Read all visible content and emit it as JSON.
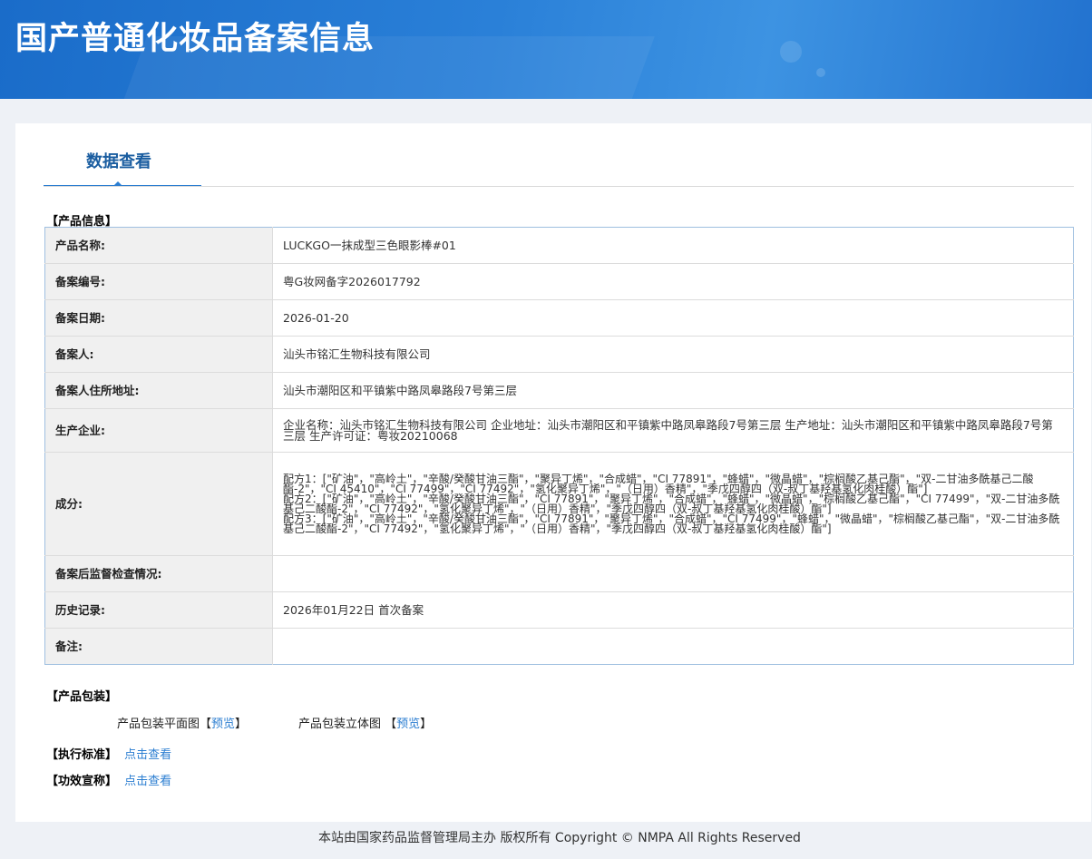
{
  "header": {
    "title": "国产普通化妆品备案信息"
  },
  "tabs": {
    "data_view": "数据查看"
  },
  "sections": {
    "product_info": "【产品信息】",
    "packaging": "【产品包装】",
    "standard": "【执行标准】",
    "efficacy": "【功效宣称】"
  },
  "product": [
    {
      "label": "产品名称:",
      "value": "LUCKGO一抹成型三色眼影棒#01"
    },
    {
      "label": "备案编号:",
      "value": "粤G妆网备字2026017792"
    },
    {
      "label": "备案日期:",
      "value": "2026-01-20"
    },
    {
      "label": "备案人:",
      "value": "汕头市铭汇生物科技有限公司"
    },
    {
      "label": "备案人住所地址:",
      "value": "汕头市潮阳区和平镇紫中路凤皋路段7号第三层"
    },
    {
      "label": "生产企业:",
      "value": "企业名称：汕头市铭汇生物科技有限公司 企业地址：汕头市潮阳区和平镇紫中路凤皋路段7号第三层 生产地址：汕头市潮阳区和平镇紫中路凤皋路段7号第三层 生产许可证：粤妆20210068"
    },
    {
      "label": "成分:",
      "value": "配方1：[\"矿油\"，\"高岭土\"，\"辛酸/癸酸甘油三酯\"，\"聚异丁烯\"，\"合成蜡\"，\"CI 77891\"，\"蜂蜡\"，\"微晶蜡\"，\"棕榈酸乙基己酯\"，\"双-二甘油多酰基己二酸酯-2\"，\"CI 45410\"，\"CI 77499\"，\"CI 77492\"，\"氢化聚异丁烯\"，\"（日用）香精\"，\"季戊四醇四（双-叔丁基羟基氢化肉桂酸）酯\"]\n配方2：[\"矿油\"，\"高岭土\"，\"辛酸/癸酸甘油三酯\"，\"CI 77891\"，\"聚异丁烯\"，\"合成蜡\"，\"蜂蜡\"，\"微晶蜡\"，\"棕榈酸乙基己酯\"，\"CI 77499\"，\"双-二甘油多酰基己二酸酯-2\"，\"CI 77492\"，\"氢化聚异丁烯\"，\"（日用）香精\"，\"季戊四醇四（双-叔丁基羟基氢化肉桂酸）酯\"]\n配方3：[\"矿油\"，\"高岭土\"，\"辛酸/癸酸甘油三酯\"，\"CI 77891\"，\"聚异丁烯\"，\"合成蜡\"，\"CI 77499\"，\"蜂蜡\"，\"微晶蜡\"，\"棕榈酸乙基己酯\"，\"双-二甘油多酰基己二酸酯-2\"，\"CI 77492\"，\"氢化聚异丁烯\"，\"（日用）香精\"，\"季戊四醇四（双-叔丁基羟基氢化肉桂酸）酯\"]"
    },
    {
      "label": "备案后监督检查情况:",
      "value": ""
    },
    {
      "label": "历史记录:",
      "value": "2026年01月22日 首次备案"
    },
    {
      "label": "备注:",
      "value": ""
    }
  ],
  "packaging": {
    "flat_label": "产品包装平面图",
    "flat_link": "预览",
    "solid_label": "产品包装立体图",
    "solid_link": "预览"
  },
  "links": {
    "standard": "点击查看",
    "efficacy": "点击查看"
  },
  "footer": "本站由国家药品监督管理局主办 版权所有 Copyright © NMPA All Rights Reserved"
}
